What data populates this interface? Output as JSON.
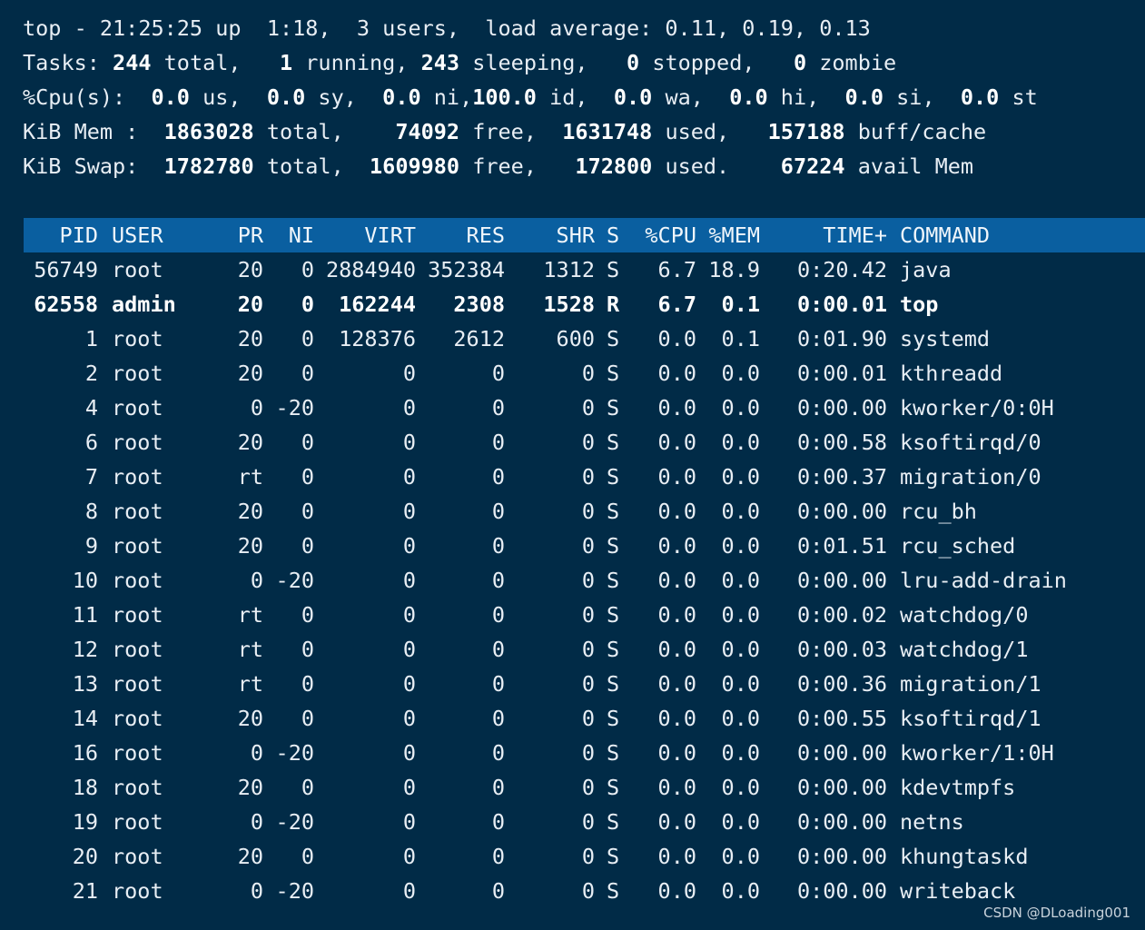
{
  "summary": {
    "l1": "top - 21:25:25 up  1:18,  3 users,  load average: 0.11, 0.19, 0.13",
    "tasks": {
      "label": "Tasks: ",
      "total": "244",
      "t1": " total,   ",
      "running": "1",
      "t2": " running, ",
      "sleeping": "243",
      "t3": " sleeping,   ",
      "stopped": "0",
      "t4": " stopped,   ",
      "zombie": "0",
      "t5": " zombie"
    },
    "cpu": {
      "label": "%Cpu(s):  ",
      "us": "0.0",
      "t1": " us,  ",
      "sy": "0.0",
      "t2": " sy,  ",
      "ni": "0.0",
      "t3": " ni,",
      "id": "100.0",
      "t4": " id,  ",
      "wa": "0.0",
      "t5": " wa,  ",
      "hi": "0.0",
      "t6": " hi,  ",
      "si": "0.0",
      "t7": " si,  ",
      "st": "0.0",
      "t8": " st"
    },
    "mem": {
      "label": "KiB Mem :  ",
      "total": "1863028",
      "t1": " total,    ",
      "free": "74092",
      "t2": " free,  ",
      "used": "1631748",
      "t3": " used,   ",
      "buff": "157188",
      "t4": " buff/cache"
    },
    "swap": {
      "label": "KiB Swap:  ",
      "total": "1782780",
      "t1": " total,  ",
      "free": "1609980",
      "t2": " free,   ",
      "used": "172800",
      "t3": " used.    ",
      "avail": "67224",
      "t4": " avail Mem"
    }
  },
  "columns": [
    "PID",
    "USER",
    "PR",
    "NI",
    "VIRT",
    "RES",
    "SHR",
    "S",
    "%CPU",
    "%MEM",
    "TIME+",
    "COMMAND"
  ],
  "processes": [
    [
      "56749",
      "root",
      "20",
      "0",
      "2884940",
      "352384",
      "1312",
      "S",
      "6.7",
      "18.9",
      "0:20.42",
      "java"
    ],
    [
      "62558",
      "admin",
      "20",
      "0",
      "162244",
      "2308",
      "1528",
      "R",
      "6.7",
      "0.1",
      "0:00.01",
      "top"
    ],
    [
      "1",
      "root",
      "20",
      "0",
      "128376",
      "2612",
      "600",
      "S",
      "0.0",
      "0.1",
      "0:01.90",
      "systemd"
    ],
    [
      "2",
      "root",
      "20",
      "0",
      "0",
      "0",
      "0",
      "S",
      "0.0",
      "0.0",
      "0:00.01",
      "kthreadd"
    ],
    [
      "4",
      "root",
      "0",
      "-20",
      "0",
      "0",
      "0",
      "S",
      "0.0",
      "0.0",
      "0:00.00",
      "kworker/0:0H"
    ],
    [
      "6",
      "root",
      "20",
      "0",
      "0",
      "0",
      "0",
      "S",
      "0.0",
      "0.0",
      "0:00.58",
      "ksoftirqd/0"
    ],
    [
      "7",
      "root",
      "rt",
      "0",
      "0",
      "0",
      "0",
      "S",
      "0.0",
      "0.0",
      "0:00.37",
      "migration/0"
    ],
    [
      "8",
      "root",
      "20",
      "0",
      "0",
      "0",
      "0",
      "S",
      "0.0",
      "0.0",
      "0:00.00",
      "rcu_bh"
    ],
    [
      "9",
      "root",
      "20",
      "0",
      "0",
      "0",
      "0",
      "S",
      "0.0",
      "0.0",
      "0:01.51",
      "rcu_sched"
    ],
    [
      "10",
      "root",
      "0",
      "-20",
      "0",
      "0",
      "0",
      "S",
      "0.0",
      "0.0",
      "0:00.00",
      "lru-add-drain"
    ],
    [
      "11",
      "root",
      "rt",
      "0",
      "0",
      "0",
      "0",
      "S",
      "0.0",
      "0.0",
      "0:00.02",
      "watchdog/0"
    ],
    [
      "12",
      "root",
      "rt",
      "0",
      "0",
      "0",
      "0",
      "S",
      "0.0",
      "0.0",
      "0:00.03",
      "watchdog/1"
    ],
    [
      "13",
      "root",
      "rt",
      "0",
      "0",
      "0",
      "0",
      "S",
      "0.0",
      "0.0",
      "0:00.36",
      "migration/1"
    ],
    [
      "14",
      "root",
      "20",
      "0",
      "0",
      "0",
      "0",
      "S",
      "0.0",
      "0.0",
      "0:00.55",
      "ksoftirqd/1"
    ],
    [
      "16",
      "root",
      "0",
      "-20",
      "0",
      "0",
      "0",
      "S",
      "0.0",
      "0.0",
      "0:00.00",
      "kworker/1:0H"
    ],
    [
      "18",
      "root",
      "20",
      "0",
      "0",
      "0",
      "0",
      "S",
      "0.0",
      "0.0",
      "0:00.00",
      "kdevtmpfs"
    ],
    [
      "19",
      "root",
      "0",
      "-20",
      "0",
      "0",
      "0",
      "S",
      "0.0",
      "0.0",
      "0:00.00",
      "netns"
    ],
    [
      "20",
      "root",
      "20",
      "0",
      "0",
      "0",
      "0",
      "S",
      "0.0",
      "0.0",
      "0:00.00",
      "khungtaskd"
    ],
    [
      "21",
      "root",
      "0",
      "-20",
      "0",
      "0",
      "0",
      "S",
      "0.0",
      "0.0",
      "0:00.00",
      "writeback"
    ]
  ],
  "highlight_row": 1,
  "watermark": "CSDN @DLoading001",
  "colors": {
    "background": "#012b47",
    "header_bar": "#0a5fa0",
    "text": "#e8eef4"
  }
}
